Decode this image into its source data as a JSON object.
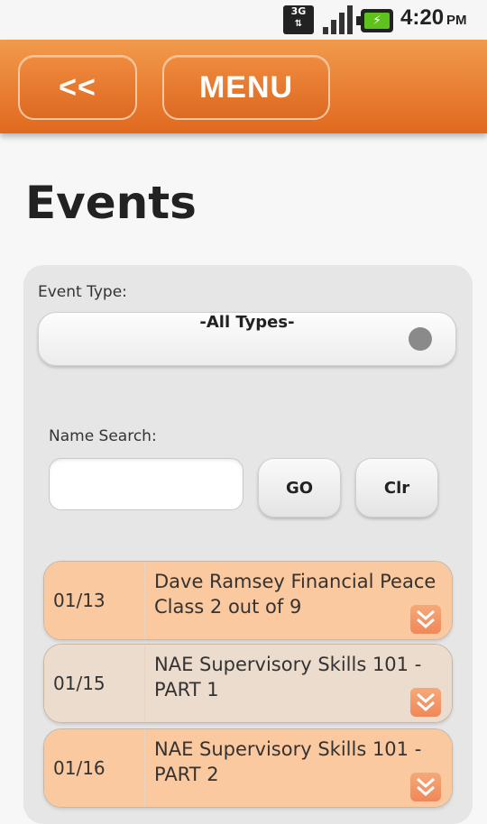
{
  "status_bar": {
    "network": "3G",
    "time": "4:20",
    "ampm": "PM"
  },
  "header": {
    "back_label": "<<",
    "menu_label": "MENU"
  },
  "page": {
    "title": "Events"
  },
  "filters": {
    "event_type_label": "Event Type:",
    "event_type_value": "-All Types-",
    "name_search_label": "Name Search:",
    "name_search_value": "",
    "go_label": "GO",
    "clear_label": "Clr"
  },
  "events": [
    {
      "date": "01/13",
      "title": "Dave Ramsey Financial Peace Class 2 out of 9"
    },
    {
      "date": "01/15",
      "title": "NAE Supervisory Skills 101 - PART 1"
    },
    {
      "date": "01/16",
      "title": "NAE Supervisory Skills 101 - PART 2"
    }
  ],
  "colors": {
    "header_orange": "#e0691e",
    "event_row": "#fbc9a0",
    "event_row_alt": "#ecdccd"
  }
}
